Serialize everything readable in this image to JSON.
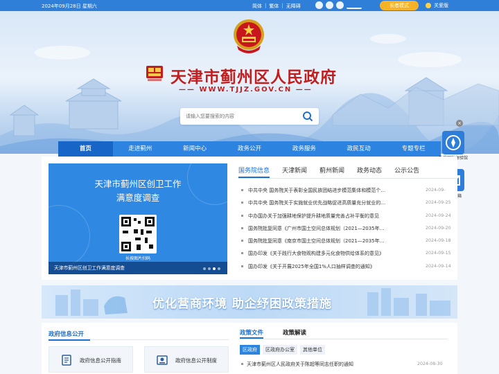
{
  "topbar": {
    "date": "2024年09月28日 星期六",
    "links": [
      "简体",
      "繁体",
      "无障碍"
    ],
    "elder_mode": "长者模式",
    "care_version": "关爱版"
  },
  "header": {
    "title": "天津市蓟州区人民政府",
    "url": "—— WWW.TJJZ.GOV.CN ——"
  },
  "search": {
    "placeholder": "请输入您要搜索的内容"
  },
  "nav": {
    "items": [
      "首页",
      "走进蓟州",
      "新闻中心",
      "政务公开",
      "政务服务",
      "政民互动",
      "专题专栏"
    ]
  },
  "floating": {
    "mini_program": "政府网站体验馆",
    "mailbox": "政务邮箱",
    "close": "×"
  },
  "slider": {
    "title_line1": "天津市蓟州区创卫工作",
    "title_line2": "满意度调查",
    "qr_tip": "长按图片扫码",
    "caption": "天津市蓟州区创卫工作满意度调查"
  },
  "news": {
    "tabs": [
      "国务院信息",
      "天津新闻",
      "蓟州新闻",
      "政务动态",
      "公示公告"
    ],
    "items": [
      {
        "title": "中共中央 国务院关于表彰全国民族团结进步模范集体和模范个…",
        "date": "2024-09-"
      },
      {
        "title": "中共中央 国务院关于实施就业优先战略促进高质量充分就业的…",
        "date": "2024-09-25"
      },
      {
        "title": "中办国办关于加强耕地保护提升耕地质量完善占补平衡的意见",
        "date": "2024-09-24"
      },
      {
        "title": "国务院批复同意《广州市国土空间总体规划（2021—2035年…",
        "date": "2024-09-20"
      },
      {
        "title": "国务院批复同意《南京市国土空间总体规划（2021—2035年…",
        "date": "2024-09-18"
      },
      {
        "title": "国办印发《关于践行大食物观构建多元化食物供给体系的意见》",
        "date": "2024-09-15"
      },
      {
        "title": "国办印发《关于开展2025年全国1%人口抽样调查的通知》",
        "date": "2024-09-14"
      }
    ]
  },
  "promo": {
    "text": "优化营商环境 助企纾困政策措施"
  },
  "info": {
    "title": "政府信息公开",
    "cards": [
      "政府信息公开指南",
      "政府信息公开制度"
    ]
  },
  "policy": {
    "tabs": [
      "政策文件",
      "政策解读"
    ],
    "subtabs": [
      "区政府",
      "区政府办公室",
      "其他单位"
    ],
    "items": [
      {
        "title": "天津市蓟州区人民政府关于陈超等同志任职的通知",
        "date": "2024-08-30"
      }
    ]
  },
  "colors": {
    "brand_blue": "#2c83e0",
    "title_red": "#c11f1f",
    "elder_orange": "#f5b329"
  }
}
